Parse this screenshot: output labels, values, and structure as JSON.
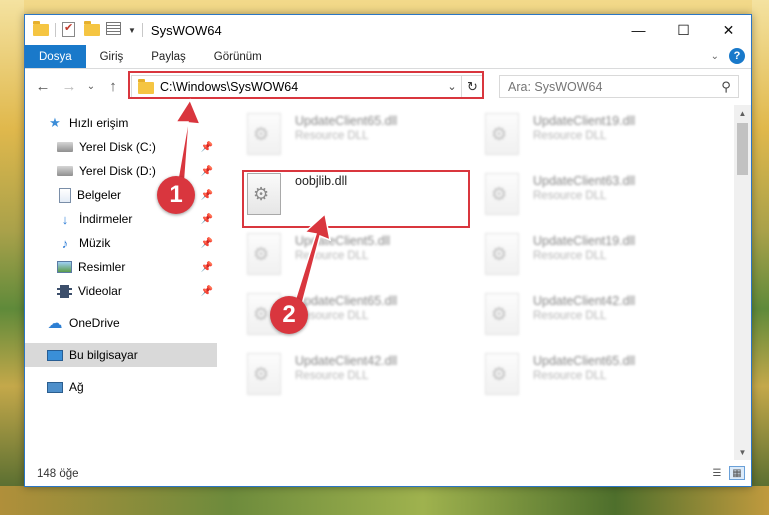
{
  "window": {
    "title": "SysWOW64",
    "controls": {
      "minimize": "—",
      "maximize": "☐",
      "close": "✕"
    }
  },
  "ribbon": {
    "tabs": [
      {
        "label": "Dosya",
        "active": true
      },
      {
        "label": "Giriş"
      },
      {
        "label": "Paylaş"
      },
      {
        "label": "Görünüm"
      }
    ],
    "help": "?"
  },
  "nav": {
    "address": "C:\\Windows\\SysWOW64",
    "search_placeholder": "Ara: SysWOW64"
  },
  "sidebar": {
    "items": [
      {
        "label": "Hızlı erişim",
        "icon": "star-icon"
      },
      {
        "label": "Yerel Disk (C:)",
        "icon": "drive-icon",
        "pinned": true
      },
      {
        "label": "Yerel Disk (D:)",
        "icon": "drive-icon",
        "pinned": true
      },
      {
        "label": "Belgeler",
        "icon": "document-icon",
        "pinned": true
      },
      {
        "label": "İndirmeler",
        "icon": "download-icon",
        "pinned": true
      },
      {
        "label": "Müzik",
        "icon": "music-icon",
        "pinned": true
      },
      {
        "label": "Resimler",
        "icon": "picture-icon",
        "pinned": true
      },
      {
        "label": "Videolar",
        "icon": "video-icon",
        "pinned": true
      },
      {
        "label": "OneDrive",
        "icon": "cloud-icon"
      },
      {
        "label": "Bu bilgisayar",
        "icon": "computer-icon",
        "selected": true
      },
      {
        "label": "Ağ",
        "icon": "network-icon"
      }
    ]
  },
  "files": {
    "focused": {
      "name": "oobjlib.dll"
    },
    "blurred": [
      {
        "name": "UpdateClient65.dll",
        "desc": "Resource DLL"
      },
      {
        "name": "UpdateClient19.dll",
        "desc": "Resource DLL"
      },
      {
        "name": "UpdateClient63.dll",
        "desc": "Resource DLL"
      },
      {
        "name": "UpdateClient5.dll",
        "desc": "Resource DLL"
      },
      {
        "name": "UpdateClient19.dll",
        "desc": "Resource DLL"
      },
      {
        "name": "UpdateClient65.dll",
        "desc": "Resource DLL"
      },
      {
        "name": "UpdateClient42.dll",
        "desc": "Resource DLL"
      },
      {
        "name": "UpdateClient42.dll",
        "desc": "Resource DLL"
      },
      {
        "name": "UpdateClient65.dll",
        "desc": "Resource DLL"
      }
    ]
  },
  "status": {
    "count": "148 öğe"
  },
  "annotations": {
    "step1": "1",
    "step2": "2",
    "color": "#d9363e"
  }
}
